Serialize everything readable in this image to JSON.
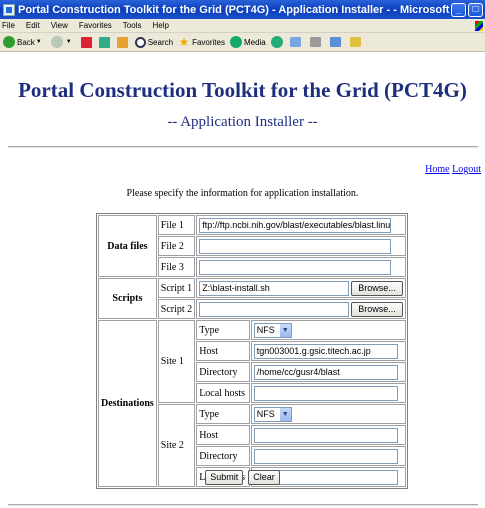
{
  "window": {
    "title": "Portal Construction Toolkit for the Grid (PCT4G) - Application Installer - - Microsoft Internet Explorer"
  },
  "menu": [
    "File",
    "Edit",
    "View",
    "Favorites",
    "Tools",
    "Help"
  ],
  "toolbar": {
    "back_label": "Back",
    "search_label": "Search",
    "favorites_label": "Favorites",
    "media_label": "Media"
  },
  "page": {
    "heading": "Portal Construction Toolkit for the Grid (PCT4G)",
    "subheading": "-- Application Installer --",
    "home_link": "Home",
    "logout_link": "Logout",
    "instruction": "Please specify the information for application installation."
  },
  "form": {
    "data_files_label": "Data files",
    "files": [
      {
        "label": "File 1",
        "value": "ftp://ftp.ncbi.nih.gov/blast/executables/blast.linux"
      },
      {
        "label": "File 2",
        "value": ""
      },
      {
        "label": "File 3",
        "value": ""
      }
    ],
    "scripts_label": "Scripts",
    "scripts": [
      {
        "label": "Script 1",
        "value": "Z:\\blast-install.sh"
      },
      {
        "label": "Script 2",
        "value": ""
      }
    ],
    "browse_label": "Browse...",
    "destinations_label": "Destinations",
    "type_label": "Type",
    "host_label": "Host",
    "directory_label": "Directory",
    "local_hosts_label": "Local hosts",
    "sites": [
      {
        "label": "Site 1",
        "type": "NFS",
        "host": "tgn003001.g.gsic.titech.ac.jp",
        "directory": "/home/cc/gusr4/blast",
        "local_hosts": ""
      },
      {
        "label": "Site 2",
        "type": "NFS",
        "host": "",
        "directory": "",
        "local_hosts": ""
      }
    ],
    "submit_label": "Submit",
    "clear_label": "Clear"
  }
}
